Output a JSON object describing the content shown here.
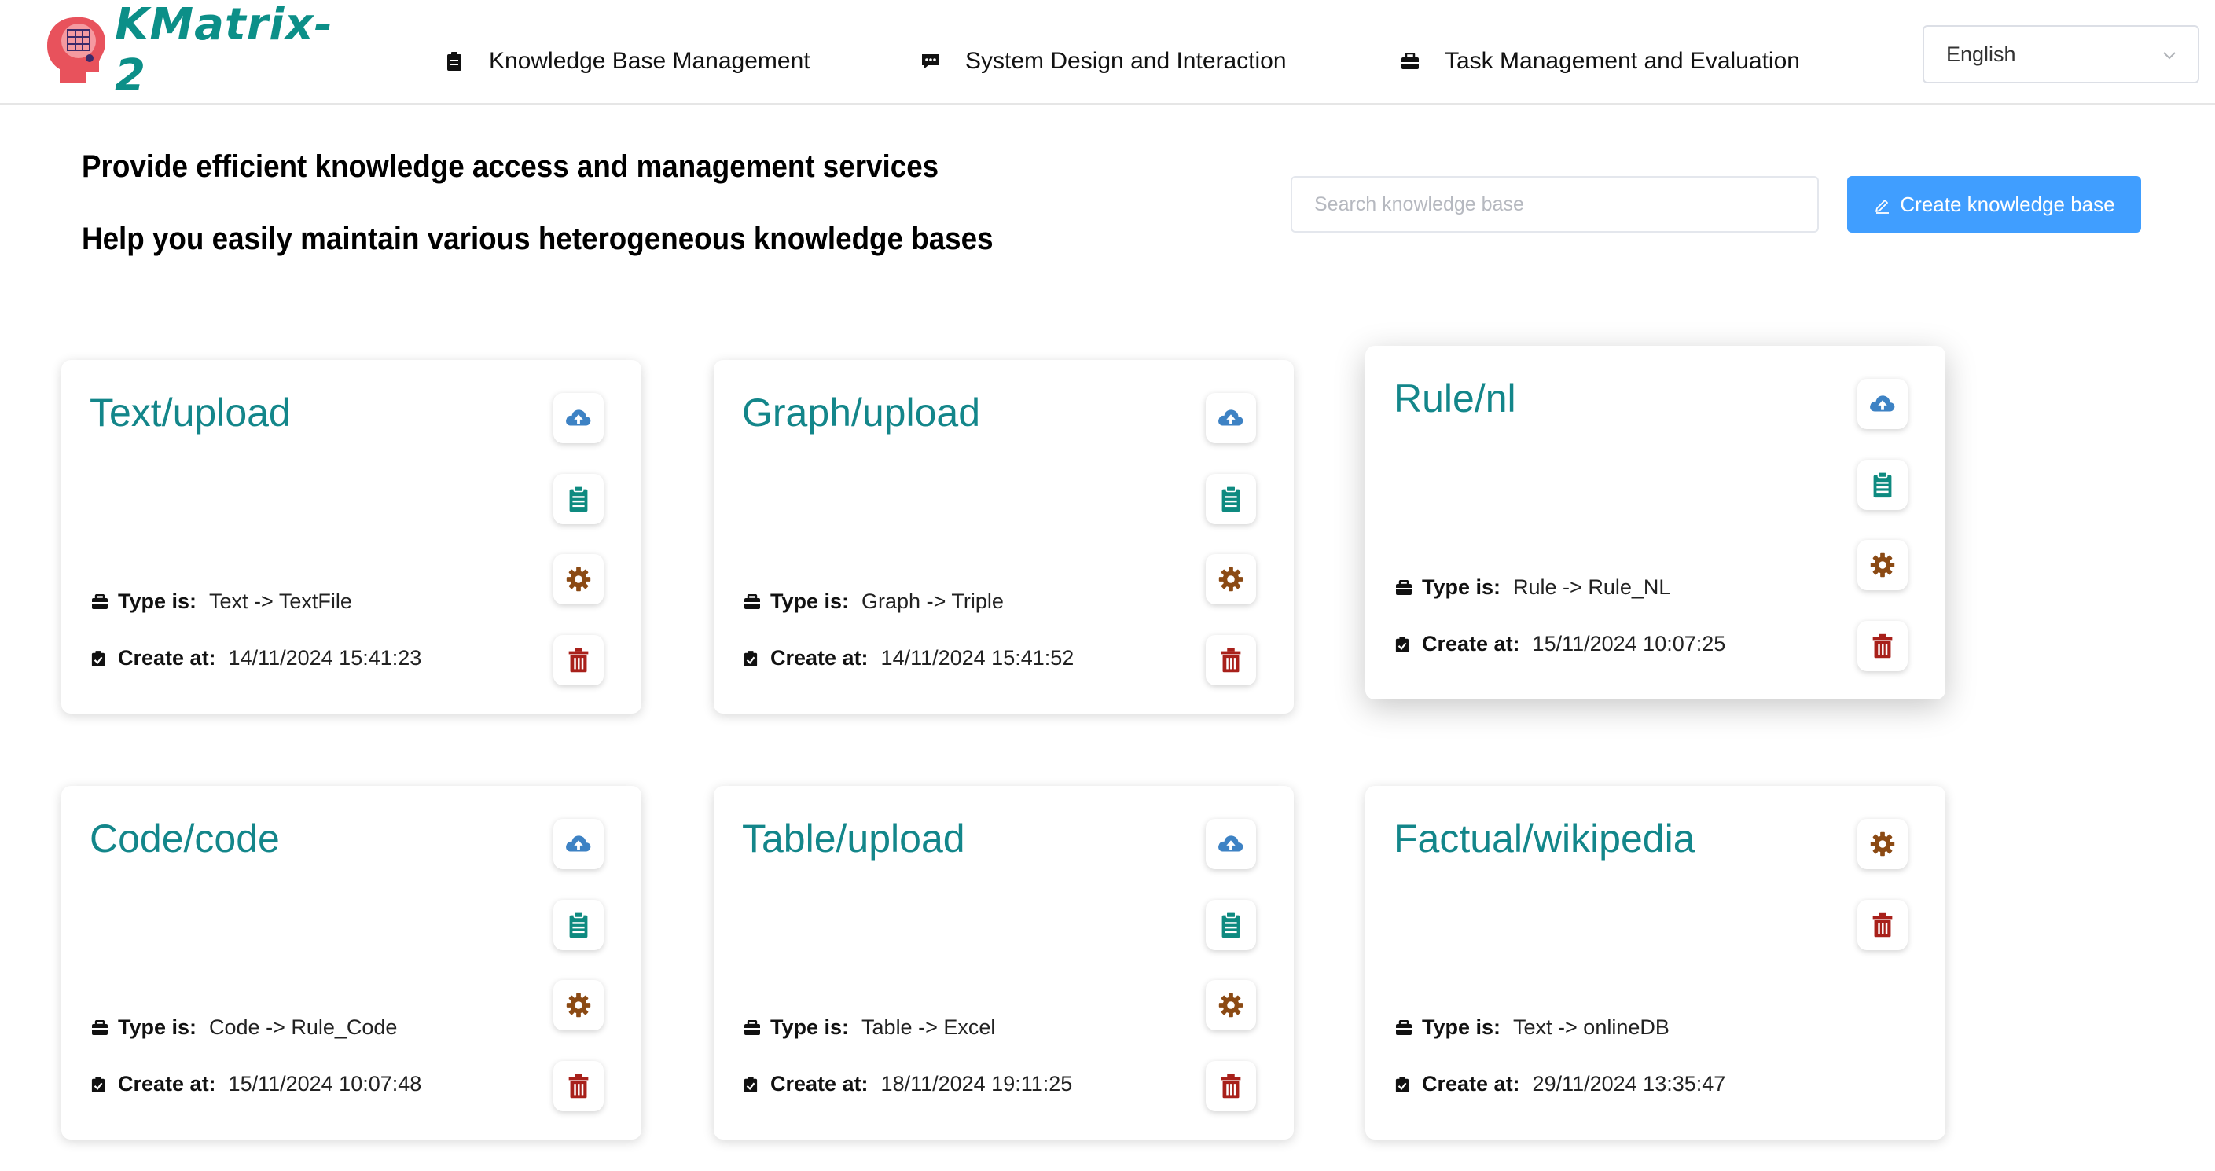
{
  "app": {
    "name": "KMatrix-2",
    "brand_color": "#0c8f88"
  },
  "nav": {
    "items": [
      {
        "label": "Knowledge Base Management",
        "icon": "clipboard-icon"
      },
      {
        "label": "System Design and Interaction",
        "icon": "chat-icon"
      },
      {
        "label": "Task Management and Evaluation",
        "icon": "briefcase-icon"
      }
    ]
  },
  "language": {
    "selected": "English"
  },
  "intro": {
    "line1": "Provide efficient knowledge access and management services",
    "line2": "Help you easily maintain various heterogeneous knowledge bases"
  },
  "search": {
    "placeholder": "Search knowledge base",
    "value": ""
  },
  "create_button": {
    "label": "Create knowledge base",
    "color": "#409eff"
  },
  "labels": {
    "type": "Type is:",
    "created": "Create at:"
  },
  "colors": {
    "upload": "#3d82c4",
    "docs": "#0e8a80",
    "settings": "#8b4a14",
    "delete": "#a8201a",
    "title": "#13868a"
  },
  "cards": [
    {
      "title": "Text/upload",
      "type": "Text -> TextFile",
      "created": "14/11/2024 15:41:23",
      "actions": [
        "upload",
        "docs",
        "settings",
        "delete"
      ]
    },
    {
      "title": "Graph/upload",
      "type": "Graph -> Triple",
      "created": "14/11/2024 15:41:52",
      "actions": [
        "upload",
        "docs",
        "settings",
        "delete"
      ]
    },
    {
      "title": "Rule/nl",
      "type": "Rule -> Rule_NL",
      "created": "15/11/2024 10:07:25",
      "actions": [
        "upload",
        "docs",
        "settings",
        "delete"
      ]
    },
    {
      "title": "Code/code",
      "type": "Code -> Rule_Code",
      "created": "15/11/2024 10:07:48",
      "actions": [
        "upload",
        "docs",
        "settings",
        "delete"
      ]
    },
    {
      "title": "Table/upload",
      "type": "Table -> Excel",
      "created": "18/11/2024 19:11:25",
      "actions": [
        "upload",
        "docs",
        "settings",
        "delete"
      ]
    },
    {
      "title": "Factual/wikipedia",
      "type": "Text -> onlineDB",
      "created": "29/11/2024 13:35:47",
      "actions": [
        "settings",
        "delete"
      ]
    }
  ]
}
